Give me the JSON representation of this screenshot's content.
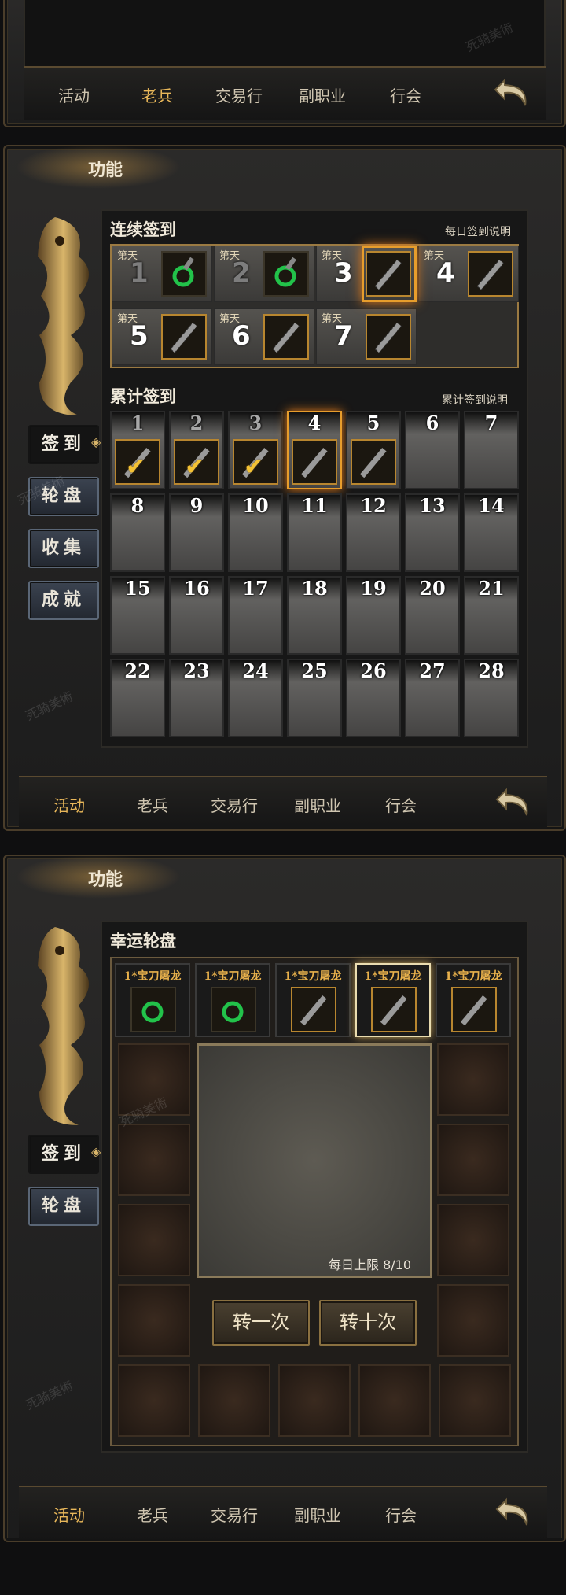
{
  "tabbar": {
    "tabs": [
      "活动",
      "老兵",
      "交易行",
      "副职业",
      "行会"
    ]
  },
  "panel1": {
    "active_tab": 1
  },
  "panel2": {
    "title": "功能",
    "side_buttons": [
      "签到",
      "轮盘",
      "收集",
      "成就"
    ],
    "streak": {
      "title": "连续签到",
      "help": "每日签到说明",
      "day_tag": "第天",
      "days": [
        "1",
        "2",
        "3",
        "4",
        "5",
        "6",
        "7"
      ]
    },
    "cumulative": {
      "title": "累计签到",
      "help": "累计签到说明",
      "days": [
        "1",
        "2",
        "3",
        "4",
        "5",
        "6",
        "7",
        "8",
        "9",
        "10",
        "11",
        "12",
        "13",
        "14",
        "15",
        "16",
        "17",
        "18",
        "19",
        "20",
        "21",
        "22",
        "23",
        "24",
        "25",
        "26",
        "27",
        "28"
      ],
      "checked_days": 3
    },
    "active_tab": 0
  },
  "panel3": {
    "title": "功能",
    "side_buttons": [
      "签到",
      "轮盘"
    ],
    "wheel": {
      "title": "幸运轮盘",
      "prize_label": "1*宝刀屠龙",
      "limit_text": "每日上限 8/10",
      "spin_once": "转一次",
      "spin_ten": "转十次"
    },
    "active_tab": 0
  },
  "watermark": "死骑美術",
  "colors": {
    "accent": "#e9b85a",
    "panel_border": "#4a3d2a",
    "gold": "#b8862f"
  }
}
